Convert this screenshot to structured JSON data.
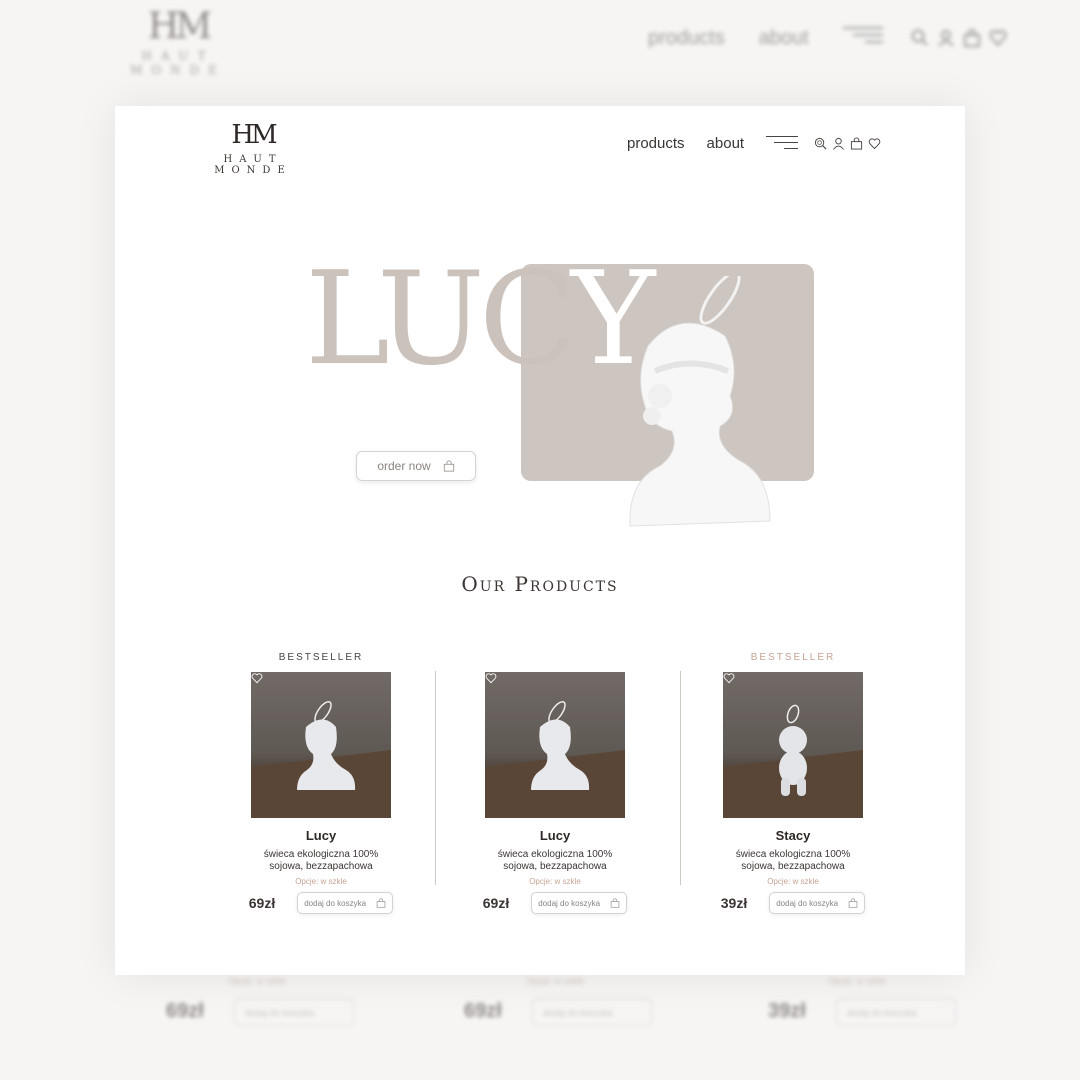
{
  "brand": {
    "monogram": "HM",
    "name": "HAUT MONDE"
  },
  "nav": {
    "products": "products",
    "about": "about"
  },
  "icons": [
    "search-icon",
    "user-icon",
    "bag-icon",
    "heart-icon"
  ],
  "hero": {
    "title_main": "LUC",
    "title_tail": "Y",
    "order_label": "order now"
  },
  "section_title": "Our Products",
  "products": [
    {
      "badge": "BESTSELLER",
      "name": "Lucy",
      "desc": "świeca ekologiczna 100% sojowa, bezzapachowa",
      "option": "Opcje: w szkle",
      "price": "69zł",
      "cart_label": "dodaj do koszyka"
    },
    {
      "badge": "",
      "name": "Lucy",
      "desc": "świeca ekologiczna 100% sojowa, bezzapachowa",
      "option": "Opcje: w szkle",
      "price": "69zł",
      "cart_label": "dodaj do koszyka"
    },
    {
      "badge": "BESTSELLER",
      "name": "Stacy",
      "desc": "świeca ekologiczna 100% sojowa, bezzapachowa",
      "option": "Opcje: w szkle",
      "price": "39zł",
      "cart_label": "dodaj do koszyka"
    }
  ],
  "colors": {
    "accent": "#c7a394",
    "hero_box": "#cdc5bf",
    "hero_text": "#cbc2bb"
  }
}
